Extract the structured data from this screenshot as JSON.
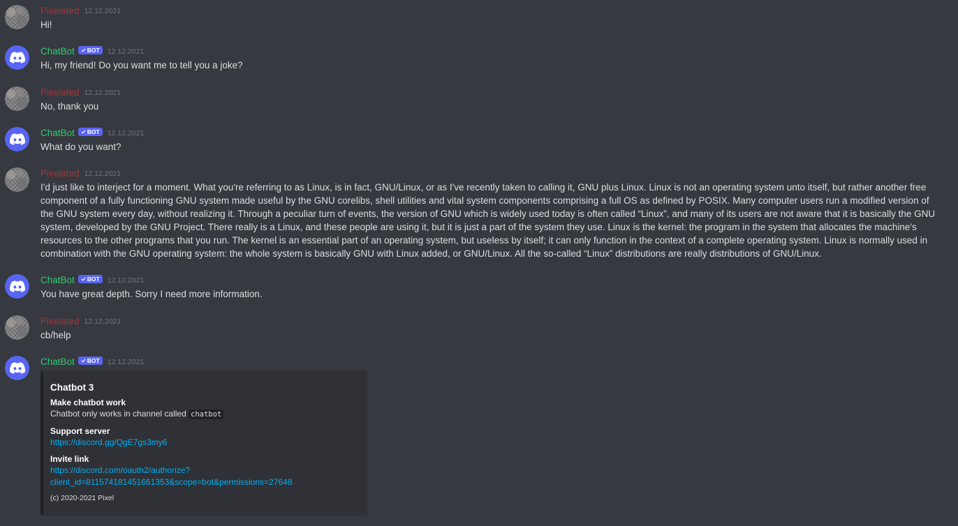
{
  "colors": {
    "background": "#36393f",
    "pixelated_name": "#a8323a",
    "bot_name": "#2ecc71",
    "bot_badge": "#5865f2",
    "link": "#00aff4",
    "embed_background": "#2f3136"
  },
  "badge_label": "BOT",
  "badge_icon": "checkmark-icon",
  "messages": [
    {
      "author": "Pixelated",
      "timestamp": "12.12.2021",
      "text": "Hi!"
    },
    {
      "author": "ChatBot",
      "timestamp": "12.12.2021",
      "text": "Hi, my friend! Do you want me to tell you a joke?"
    },
    {
      "author": "Pixelated",
      "timestamp": "12.12.2021",
      "text": "No, thank you"
    },
    {
      "author": "ChatBot",
      "timestamp": "12.12.2021",
      "text": "What do you want?"
    },
    {
      "author": "Pixelated",
      "timestamp": "12.12.2021",
      "text": "I'd just like to interject for a moment. What you're referring to as Linux, is in fact, GNU/Linux, or as I've recently taken to calling it, GNU plus Linux. Linux is not an operating system unto itself, but rather another free component of a fully functioning GNU system made useful by the GNU corelibs, shell utilities and vital system components comprising a full OS as defined by POSIX. Many computer users run a modified version of the GNU system every day, without realizing it. Through a peculiar turn of events, the version of GNU which is widely used today is often called “Linux”, and many of its users are not aware that it is basically the GNU system, developed by the GNU Project. There really is a Linux, and these people are using it, but it is just a part of the system they use. Linux is the kernel: the program in the system that allocates the machine's resources to the other programs that you run. The kernel is an essential part of an operating system, but useless by itself; it can only function in the context of a complete operating system. Linux is normally used in combination with the GNU operating system: the whole system is basically GNU with Linux added, or GNU/Linux. All the so-called “Linux” distributions are really distributions of GNU/Linux."
    },
    {
      "author": "ChatBot",
      "timestamp": "12.12.2021",
      "text": "You have great depth. Sorry I need more information."
    },
    {
      "author": "Pixelated",
      "timestamp": "12.12.2021",
      "text": "cb/help"
    },
    {
      "author": "ChatBot",
      "timestamp": "12.12.2021",
      "embed": {
        "title": "Chatbot 3",
        "fields": [
          {
            "name": "Make chatbot work",
            "value_prefix": "Chatbot only works in channel called ",
            "value_code": "chatbot"
          },
          {
            "name": "Support server",
            "link": "https://discord.gg/QgE7gs3my6"
          },
          {
            "name": "Invite link",
            "link_line1": "https://discord.com/oauth2/authorize?",
            "link_line2": "client_id=811574181451661353&scope=bot&permissions=27648"
          }
        ],
        "footer": "(c) 2020-2021 Pixel"
      }
    }
  ]
}
